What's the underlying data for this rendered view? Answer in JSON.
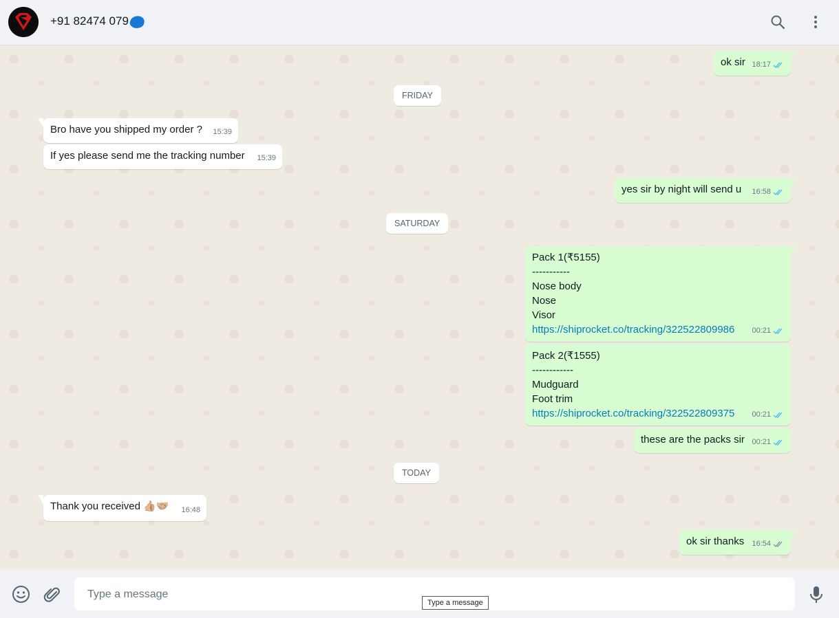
{
  "header": {
    "contact_name": "+91 82474 079"
  },
  "days": [
    {
      "label": "FRIDAY"
    },
    {
      "label": "SATURDAY"
    },
    {
      "label": "TODAY"
    }
  ],
  "messages": [
    {
      "text": "ok sir",
      "time": "18:17"
    },
    {
      "text": "Bro have you shipped my order ?",
      "time": "15:39"
    },
    {
      "text": "If yes please send me the tracking number",
      "time": "15:39"
    },
    {
      "text": "yes sir by night will send u",
      "time": "16:58"
    },
    {
      "lines": [
        "Pack 1(₹5155)",
        "-----------",
        "Nose body",
        "Nose",
        "Visor"
      ],
      "link": "https://shiprocket.co/tracking/322522809986",
      "time": "00:21"
    },
    {
      "lines": [
        "Pack 2(₹1555)",
        "------------",
        "Mudguard",
        "Foot trim"
      ],
      "link": "https://shiprocket.co/tracking/322522809375",
      "time": "00:21"
    },
    {
      "text": "these are the packs sir",
      "time": "00:21"
    },
    {
      "text": "Thank you received 👍🏼🤝🏼",
      "time": "16:48"
    },
    {
      "text": "ok sir thanks",
      "time": "16:54"
    }
  ],
  "composer": {
    "placeholder": "Type a message",
    "tooltip": "Type a message"
  },
  "colors": {
    "outgoing_bubble": "#d9fdd3",
    "incoming_bubble": "#ffffff",
    "read_ticks": "#53bdeb",
    "link": "#027eb5"
  },
  "icons": [
    "search-icon",
    "menu-icon",
    "emoji-icon",
    "attach-icon",
    "mic-icon",
    "double-check-icon"
  ]
}
